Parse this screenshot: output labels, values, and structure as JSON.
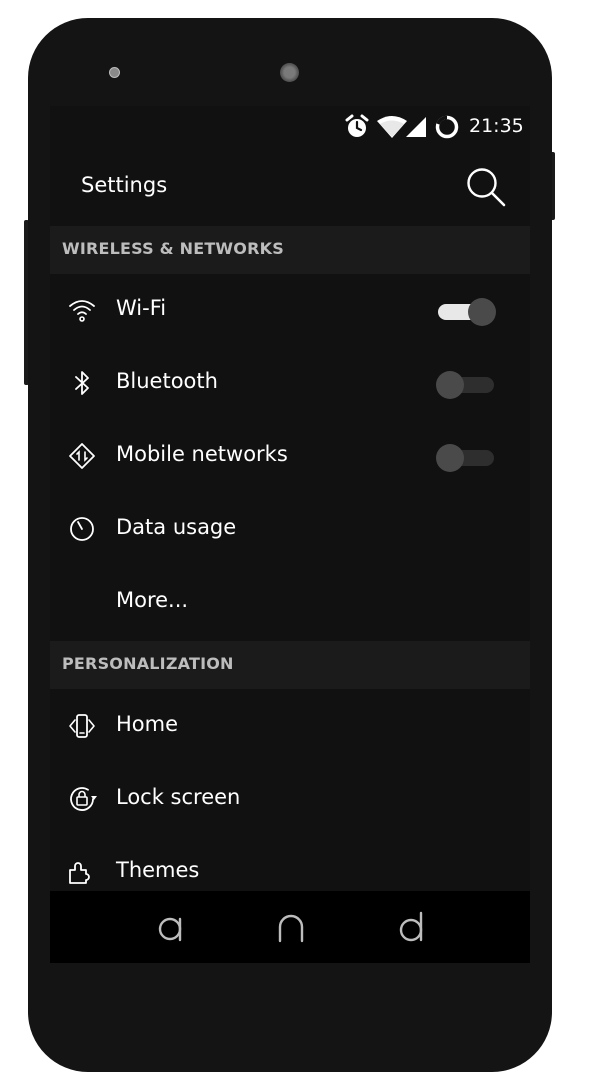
{
  "status_bar": {
    "time": "21:35",
    "icons": [
      "alarm-icon",
      "wifi-signal-icon",
      "cell-signal-icon",
      "battery-ring-icon"
    ]
  },
  "app_bar": {
    "title": "Settings",
    "search_icon": "search-icon"
  },
  "sections": [
    {
      "title": "WIRELESS & NETWORKS",
      "items": [
        {
          "label": "Wi-Fi",
          "icon": "wifi-icon",
          "toggle": true,
          "toggle_on": true
        },
        {
          "label": "Bluetooth",
          "icon": "bluetooth-icon",
          "toggle": true,
          "toggle_on": false
        },
        {
          "label": "Mobile networks",
          "icon": "mobile-network-icon",
          "toggle": true,
          "toggle_on": false
        },
        {
          "label": "Data usage",
          "icon": "data-usage-icon",
          "toggle": false
        },
        {
          "label": "More...",
          "icon": "",
          "toggle": false
        }
      ]
    },
    {
      "title": "PERSONALIZATION",
      "items": [
        {
          "label": "Home",
          "icon": "home-phone-icon",
          "toggle": false
        },
        {
          "label": "Lock screen",
          "icon": "lock-screen-icon",
          "toggle": false
        },
        {
          "label": "Themes",
          "icon": "themes-icon",
          "toggle": false
        }
      ]
    }
  ],
  "nav_bar": {
    "buttons": [
      "back-button",
      "home-button",
      "recents-button"
    ]
  },
  "colors": {
    "screen_background": "#111111",
    "section_header_background": "#1b1b1b",
    "section_header_text": "#bdbdbd",
    "text": "#ffffff",
    "toggle_on_track": "#e8e8e8",
    "toggle_thumb": "#4a4a4a",
    "toggle_off_track": "#2e2e2e",
    "phone_body": "#141414",
    "nav_bar": "#000000"
  }
}
